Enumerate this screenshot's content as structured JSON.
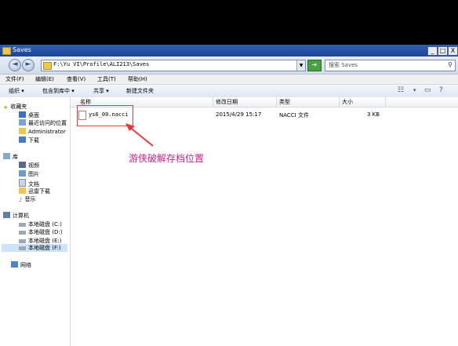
{
  "window": {
    "title": "Saves",
    "controls": {
      "minimize": "_",
      "maximize": "□",
      "close": "X"
    }
  },
  "address": {
    "path": "F:\\Yu VI\\Profile\\ALI213\\Saves",
    "search_placeholder": "搜索 Saves"
  },
  "menu": [
    "文件(F)",
    "编辑(E)",
    "查看(V)",
    "工具(T)",
    "帮助(H)"
  ],
  "command_bar": [
    "组织 ▾",
    "包含到库中 ▾",
    "共享 ▾",
    "新建文件夹"
  ],
  "nav": {
    "favorites": {
      "title": "收藏夹",
      "items": [
        "桌面",
        "最近访问的位置",
        "Administrator",
        "下载"
      ]
    },
    "libraries": {
      "title": "库",
      "items": [
        "视频",
        "图片",
        "文档",
        "迅雷下载",
        "音乐"
      ]
    },
    "computer": {
      "title": "计算机",
      "items": [
        "本地磁盘 (C:)",
        "本地磁盘 (D:)",
        "本地磁盘 (E:)",
        "本地磁盘 (F:)"
      ]
    },
    "network": {
      "title": "网络"
    }
  },
  "columns": {
    "name": "名称",
    "date": "修改日期",
    "type": "类型",
    "size": "大小"
  },
  "files": [
    {
      "name": "ys6_00.nacci",
      "date": "2015/4/29 15:17",
      "type": "NACCI 文件",
      "size": "3 KB"
    }
  ],
  "annotation": {
    "text": "游侠破解存档位置",
    "color": "#c8208c",
    "box_color": "#e03a3a"
  }
}
